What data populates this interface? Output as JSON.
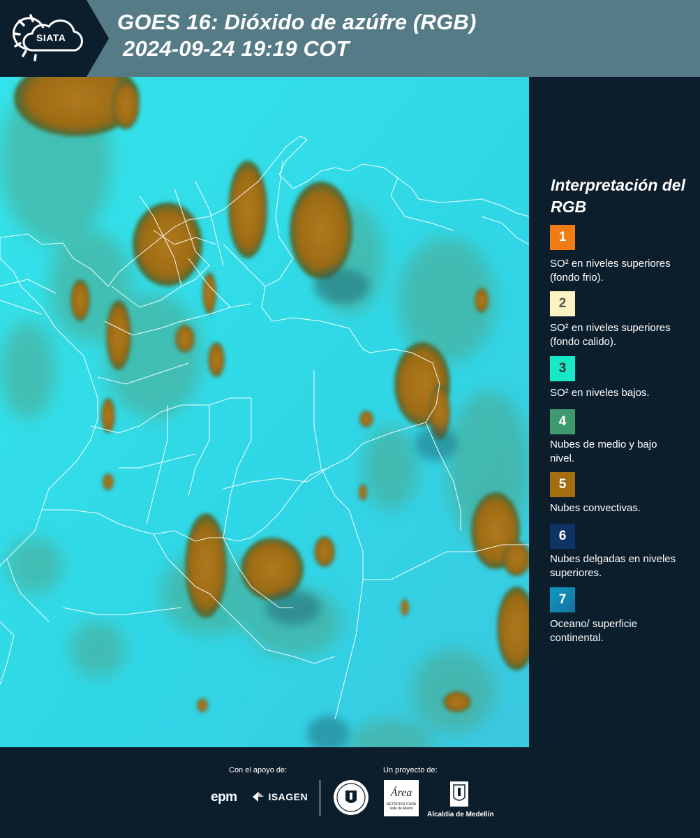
{
  "header": {
    "logo_text": "SIATA",
    "title_line1": "GOES 16: Dióxido de azúfre (RGB)",
    "title_line2": "2024-09-24 19:19 COT"
  },
  "map": {
    "background_color": "#2ed8e6",
    "border_color": "#ffffff"
  },
  "legend": {
    "title": "Interpretación del RGB",
    "items": [
      {
        "number": "1",
        "color": "#f07d14",
        "text_color": "#ffffff",
        "label": "SO² en niveles superiores (fondo frio)."
      },
      {
        "number": "2",
        "color": "#fdf3c2",
        "text_color": "#444444",
        "label": "SO² en niveles superiores (fondo calido)."
      },
      {
        "number": "3",
        "color": "#17e8c8",
        "text_color": "#333333",
        "label": "SO² en niveles bajos."
      },
      {
        "number": "4",
        "color": "#3e9a6e",
        "text_color": "#ffffff",
        "label": "Nubes de medio y bajo nivel."
      },
      {
        "number": "5",
        "color": "#a46d10",
        "text_color": "#ffffff",
        "label": "Nubes convectivas."
      },
      {
        "number": "6",
        "color": "#0f3366",
        "text_color": "#ffffff",
        "label": "Nubes delgadas en niveles superiores."
      },
      {
        "number": "7",
        "color": "#1a8ab0",
        "text_color": "#ffffff",
        "label": "Oceano/ superficie continental."
      }
    ]
  },
  "footer": {
    "support_label": "Con el apoyo de:",
    "project_label": "Un proyecto de:",
    "epm_logo": "epm",
    "isagen_logo": "ISAGEN",
    "area_logo_top": "Área",
    "area_logo_sub": "METROPOLITANA",
    "area_logo_sub2": "Valle de Aburrá",
    "alcaldia_logo": "Alcaldía de Medellín"
  }
}
